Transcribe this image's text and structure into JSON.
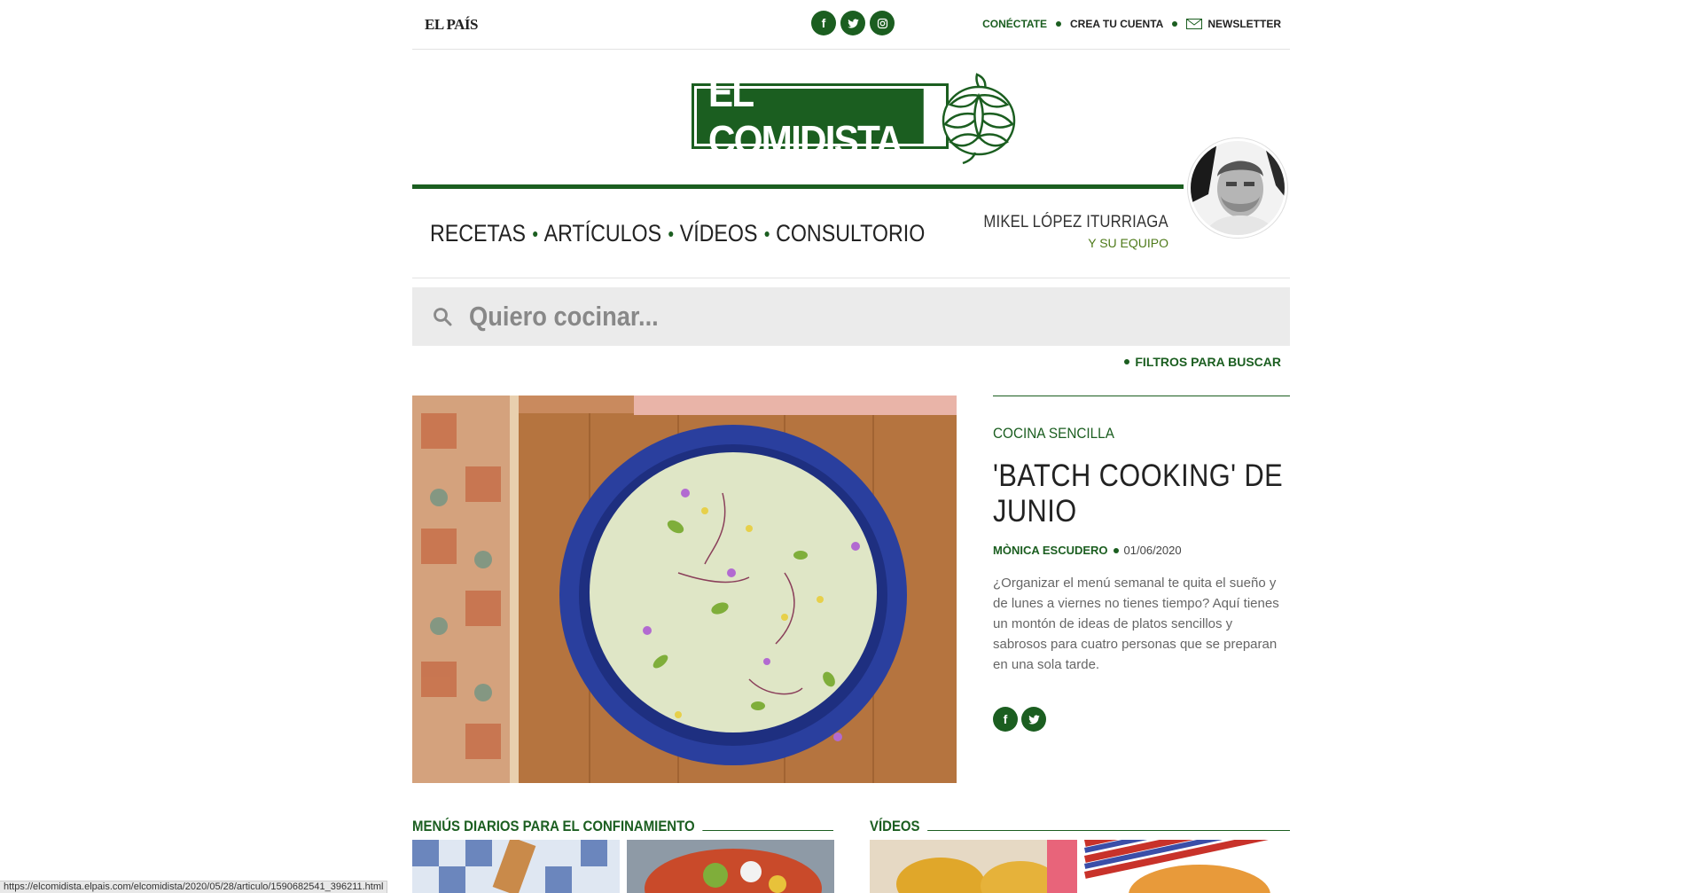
{
  "topbar": {
    "brand": "EL PAÍS",
    "social": [
      "facebook-icon",
      "twitter-icon",
      "instagram-icon"
    ],
    "links": {
      "connect": "CONÉCTATE",
      "signup": "CREA TU CUENTA",
      "newsletter": "NEWSLETTER"
    }
  },
  "logo": {
    "text": "EL COMIDISTA"
  },
  "nav": {
    "items": [
      "RECETAS",
      "ARTÍCULOS",
      "VÍDEOS",
      "CONSULTORIO"
    ],
    "author_name": "MIKEL LÓPEZ ITURRIAGA",
    "author_team": "Y SU EQUIPO"
  },
  "search": {
    "placeholder": "Quiero cocinar...",
    "filters_label": "FILTROS PARA BUSCAR"
  },
  "feature": {
    "kicker": "COCINA SENCILLA",
    "title": "'BATCH COOKING' DE JUNIO",
    "author": "MÒNICA ESCUDERO",
    "date": "01/06/2020",
    "summary": "¿Organizar el menú semanal te quita el sueño y de lunes a viernes no tienes tiempo? Aquí tienes un montón de ideas de platos sencillos y sabrosos para cuatro personas que se preparan en una sola tarde."
  },
  "sections": {
    "menus": "MENÚS DIARIOS PARA EL CONFINAMIENTO",
    "videos": "VÍDEOS"
  },
  "statusbar": {
    "url": "https://elcomidista.elpais.com/elcomidista/2020/05/28/articulo/1590682541_396211.html"
  },
  "colors": {
    "brand_green": "#1b5e20",
    "search_bg": "#ebebeb"
  }
}
